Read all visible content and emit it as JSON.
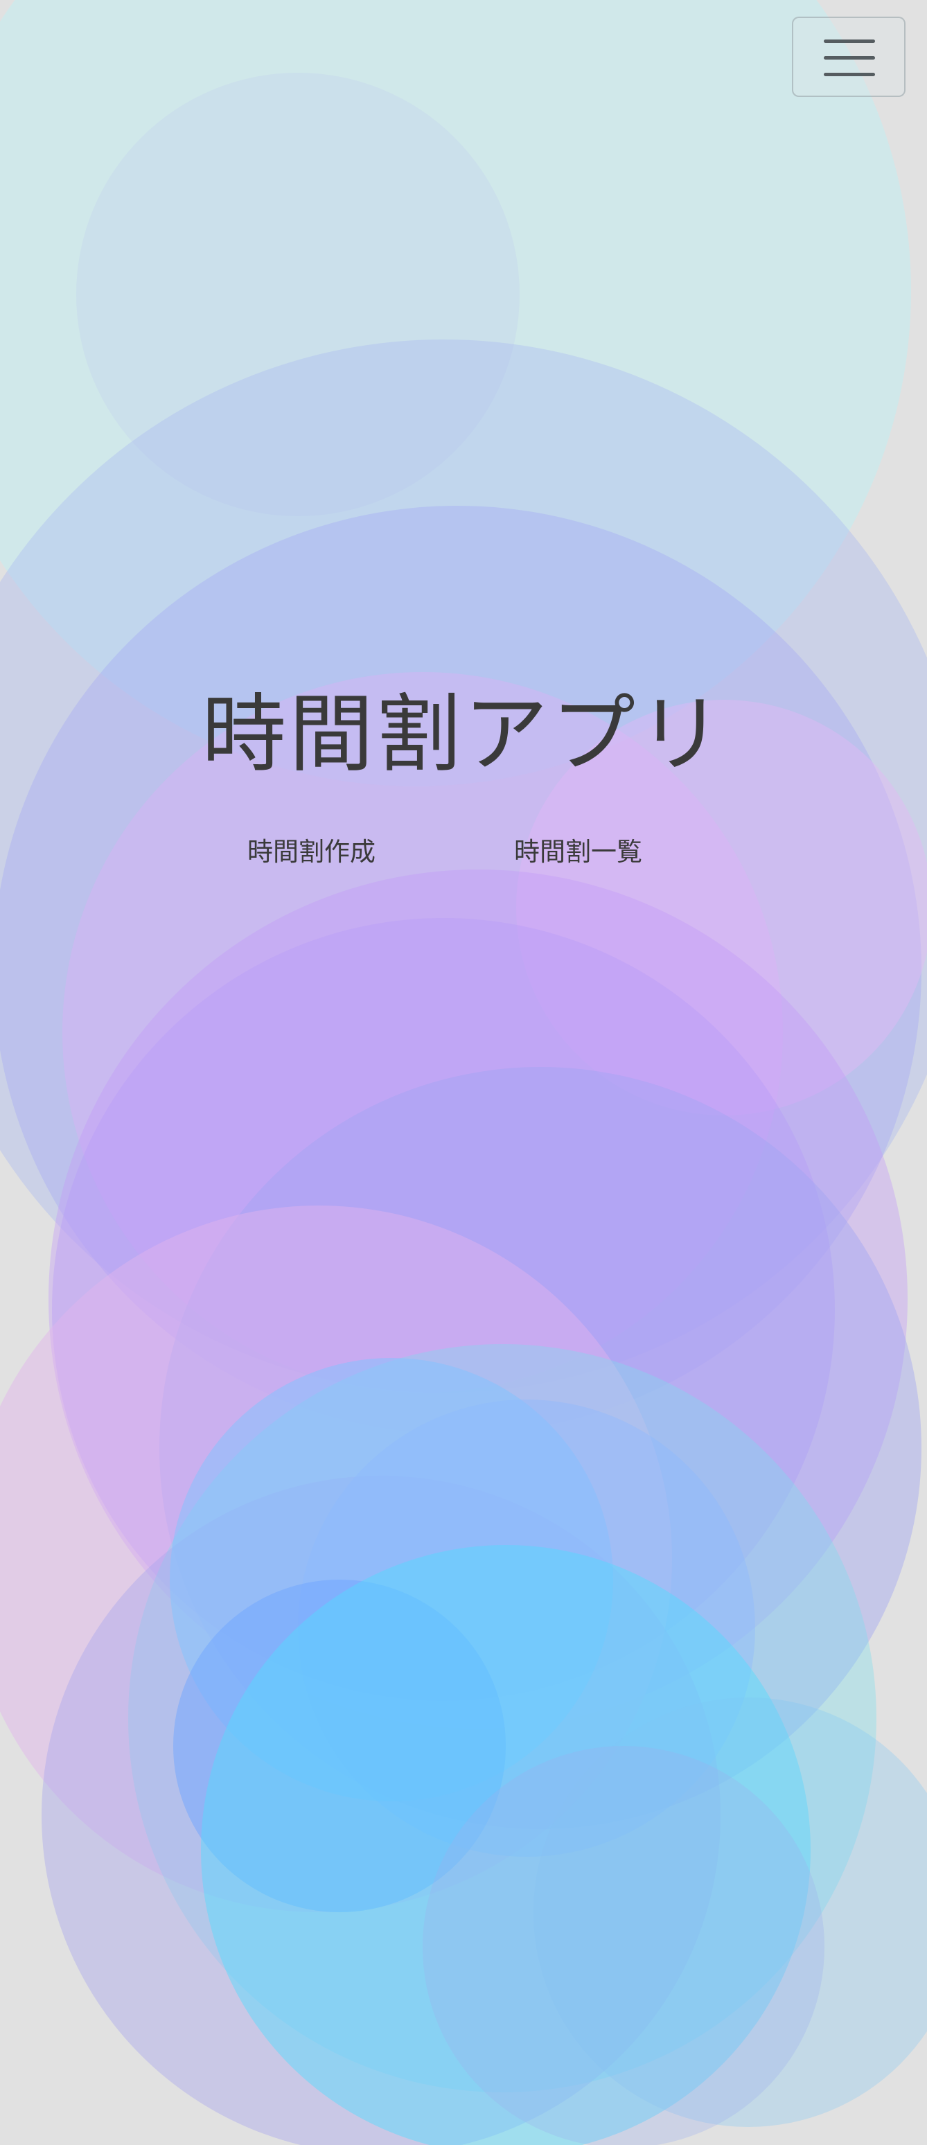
{
  "app": {
    "title": "時間割アプリ"
  },
  "nav": {
    "links": [
      {
        "label": "時間割作成"
      },
      {
        "label": "時間割一覧"
      }
    ]
  },
  "menu": {
    "icon": "hamburger-menu-icon"
  },
  "colors": {
    "background": "#e1e1e1",
    "bubble_teal": "#a8dde6",
    "bubble_blue": "#7aa8ff",
    "bubble_violet": "#b18cff",
    "bubble_pink": "#e6a8f5",
    "bubble_cyan": "#4fe0ff",
    "text": "#3a3a3a"
  }
}
